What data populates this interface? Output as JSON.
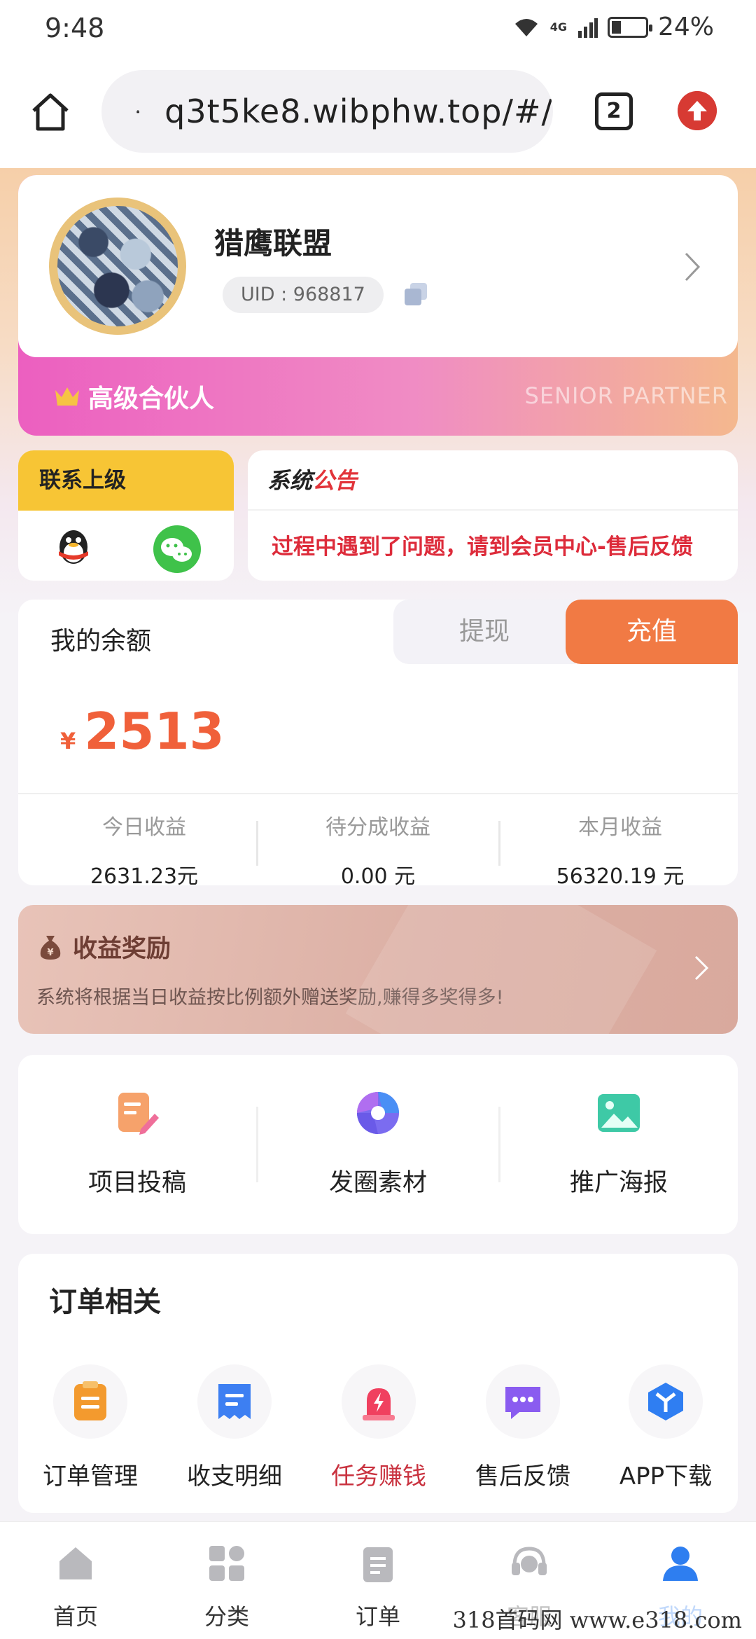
{
  "status_bar": {
    "time": "9:48",
    "network": "4G",
    "battery": "24%"
  },
  "browser": {
    "url": "q3t5ke8.wibphw.top/#/",
    "tab_count": "2"
  },
  "profile": {
    "name": "猎鹰联盟",
    "uid": "UID : 968817",
    "rank": "高级合伙人",
    "rank_en": "SENIOR PARTNER"
  },
  "contact": {
    "title": "联系上级"
  },
  "notice": {
    "title_a": "系统",
    "title_b": "公告",
    "text": "过程中遇到了问题，请到会员中心-售后反馈"
  },
  "balance": {
    "title": "我的余额",
    "withdraw_label": "提现",
    "recharge_label": "充值",
    "currency": "¥",
    "amount": "2513",
    "stats": [
      {
        "label": "今日收益",
        "value": "2631.23元"
      },
      {
        "label": "待分成收益",
        "value": "0.00 元"
      },
      {
        "label": "本月收益",
        "value": "56320.19 元"
      }
    ]
  },
  "reward": {
    "title": "收益奖励",
    "desc": "系统将根据当日收益按比例额外赠送奖励,赚得多奖得多!"
  },
  "tools": [
    {
      "label": "项目投稿",
      "icon": "edit-doc-icon"
    },
    {
      "label": "发圈素材",
      "icon": "aperture-icon"
    },
    {
      "label": "推广海报",
      "icon": "image-icon"
    }
  ],
  "orders": {
    "title": "订单相关",
    "items": [
      {
        "label": "订单管理",
        "icon": "order-list-icon"
      },
      {
        "label": "收支明细",
        "icon": "bill-icon"
      },
      {
        "label": "任务赚钱",
        "icon": "task-alarm-icon"
      },
      {
        "label": "售后反馈",
        "icon": "chat-icon"
      },
      {
        "label": "APP下载",
        "icon": "app-box-icon"
      }
    ]
  },
  "bottom_nav": [
    {
      "label": "首页",
      "icon": "home-icon"
    },
    {
      "label": "分类",
      "icon": "grid-icon"
    },
    {
      "label": "订单",
      "icon": "clipboard-icon"
    },
    {
      "label": "客服",
      "icon": "headset-icon"
    },
    {
      "label": "我的",
      "icon": "user-icon",
      "active": true
    }
  ],
  "watermark": "318首码网 www.e318.com",
  "colors": {
    "accent_orange": "#f17a44",
    "amount_red": "#f0603a",
    "nav_active": "#2e7ef0",
    "notice_red": "#e2343a"
  }
}
